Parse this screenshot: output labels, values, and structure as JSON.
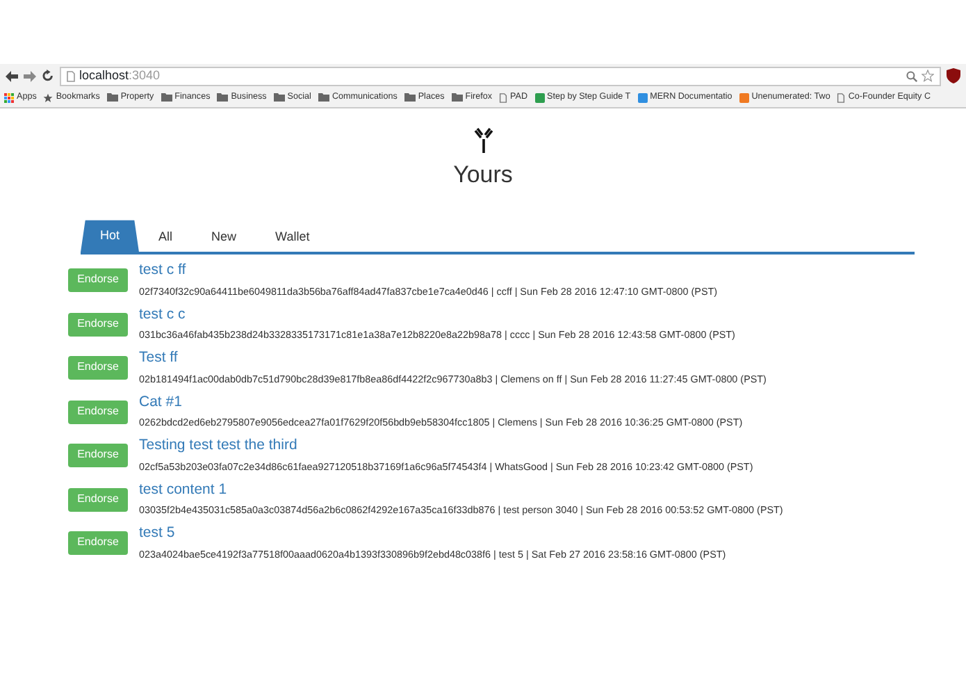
{
  "browser": {
    "url_host": "localhost",
    "url_port": ":3040",
    "bookmarks": [
      {
        "label": "Apps",
        "kind": "apps"
      },
      {
        "label": "Bookmarks",
        "kind": "star"
      },
      {
        "label": "Property",
        "kind": "folder"
      },
      {
        "label": "Finances",
        "kind": "folder"
      },
      {
        "label": "Business",
        "kind": "folder"
      },
      {
        "label": "Social",
        "kind": "folder"
      },
      {
        "label": "Communications",
        "kind": "folder"
      },
      {
        "label": "Places",
        "kind": "folder"
      },
      {
        "label": "Firefox",
        "kind": "folder"
      },
      {
        "label": "PAD",
        "kind": "page"
      },
      {
        "label": "Step by Step Guide T",
        "kind": "site",
        "color": "#2e9e4f"
      },
      {
        "label": "MERN Documentatio",
        "kind": "site",
        "color": "#2f8fe0"
      },
      {
        "label": "Unenumerated: Two",
        "kind": "site",
        "color": "#f07a22"
      },
      {
        "label": "Co-Founder Equity C",
        "kind": "page"
      }
    ]
  },
  "page": {
    "title": "Yours"
  },
  "tabs": [
    {
      "label": "Hot",
      "selected": true
    },
    {
      "label": "All",
      "selected": false
    },
    {
      "label": "New",
      "selected": false
    },
    {
      "label": "Wallet",
      "selected": false
    }
  ],
  "posts": [
    {
      "button": "Endorse",
      "title": "test c ff",
      "meta": "02f7340f32c90a64411be6049811da3b56ba76aff84ad47fa837cbe1e7ca4e0d46 | ccff | Sun Feb 28 2016 12:47:10 GMT-0800 (PST)"
    },
    {
      "button": "Endorse",
      "title": "test c c",
      "meta": "031bc36a46fab435b238d24b3328335173171c81e1a38a7e12b8220e8a22b98a78 | cccc | Sun Feb 28 2016 12:43:58 GMT-0800 (PST)"
    },
    {
      "button": "Endorse",
      "title": "Test ff",
      "meta": "02b181494f1ac00dab0db7c51d790bc28d39e817fb8ea86df4422f2c967730a8b3 | Clemens on ff | Sun Feb 28 2016 11:27:45 GMT-0800 (PST)"
    },
    {
      "button": "Endorse",
      "title": "Cat #1",
      "meta": "0262bdcd2ed6eb2795807e9056edcea27fa01f7629f20f56bdb9eb58304fcc1805 | Clemens | Sun Feb 28 2016 10:36:25 GMT-0800 (PST)"
    },
    {
      "button": "Endorse",
      "title": "Testing test test the third",
      "meta": "02cf5a53b203e03fa07c2e34d86c61faea927120518b37169f1a6c96a5f74543f4 | WhatsGood | Sun Feb 28 2016 10:23:42 GMT-0800 (PST)"
    },
    {
      "button": "Endorse",
      "title": "test content 1",
      "meta": "03035f2b4e435031c585a0a3c03874d56a2b6c0862f4292e167a35ca16f33db876 | test person 3040 | Sun Feb 28 2016 00:53:52 GMT-0800 (PST)"
    },
    {
      "button": "Endorse",
      "title": "test 5",
      "meta": "023a4024bae5ce4192f3a77518f00aaad0620a4b1393f330896b9f2ebd48c038f6 | test 5 | Sat Feb 27 2016 23:58:16 GMT-0800 (PST)"
    }
  ]
}
